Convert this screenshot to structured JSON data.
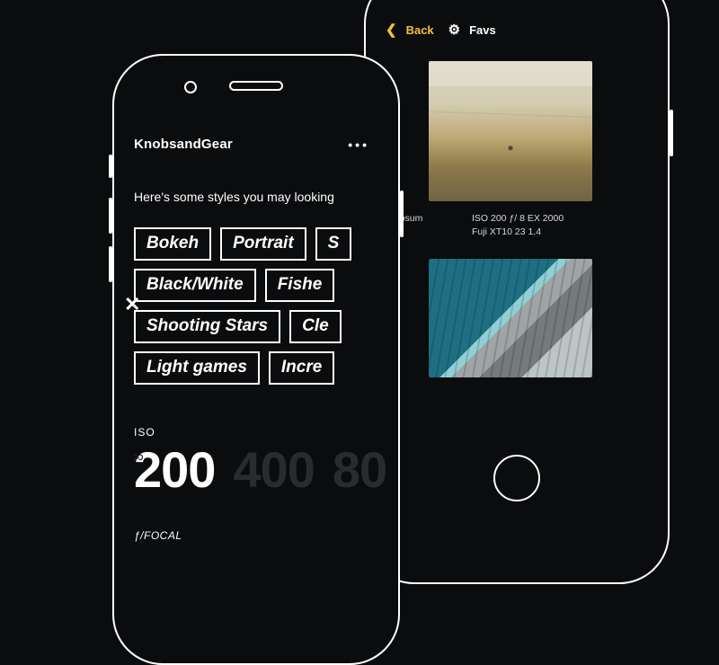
{
  "colors": {
    "accent": "#f2c335"
  },
  "front": {
    "app_title": "KnobsandGear",
    "more_label": "•••",
    "close_label": "✕",
    "subhead": "Here's some styles you may looking",
    "tags": {
      "row1": [
        "Bokeh",
        "Portrait",
        "S"
      ],
      "row2": [
        "Black/White",
        "Fishe"
      ],
      "row3": [
        "Shooting Stars",
        "Cle"
      ],
      "row4": [
        "Light games",
        "Incre"
      ]
    },
    "iso": {
      "label": "ISO",
      "selected": "200",
      "dim1": "400",
      "dim2": "80"
    },
    "focal_label": "ƒ/FOCAL"
  },
  "back": {
    "nav": {
      "back": "Back",
      "favs": "Favs"
    },
    "photo1": {
      "caption_left": "n Ipsum",
      "caption_right": "ISO 200 ƒ/ 8 EX 2000\nFuji XT10 23 1.4"
    }
  }
}
